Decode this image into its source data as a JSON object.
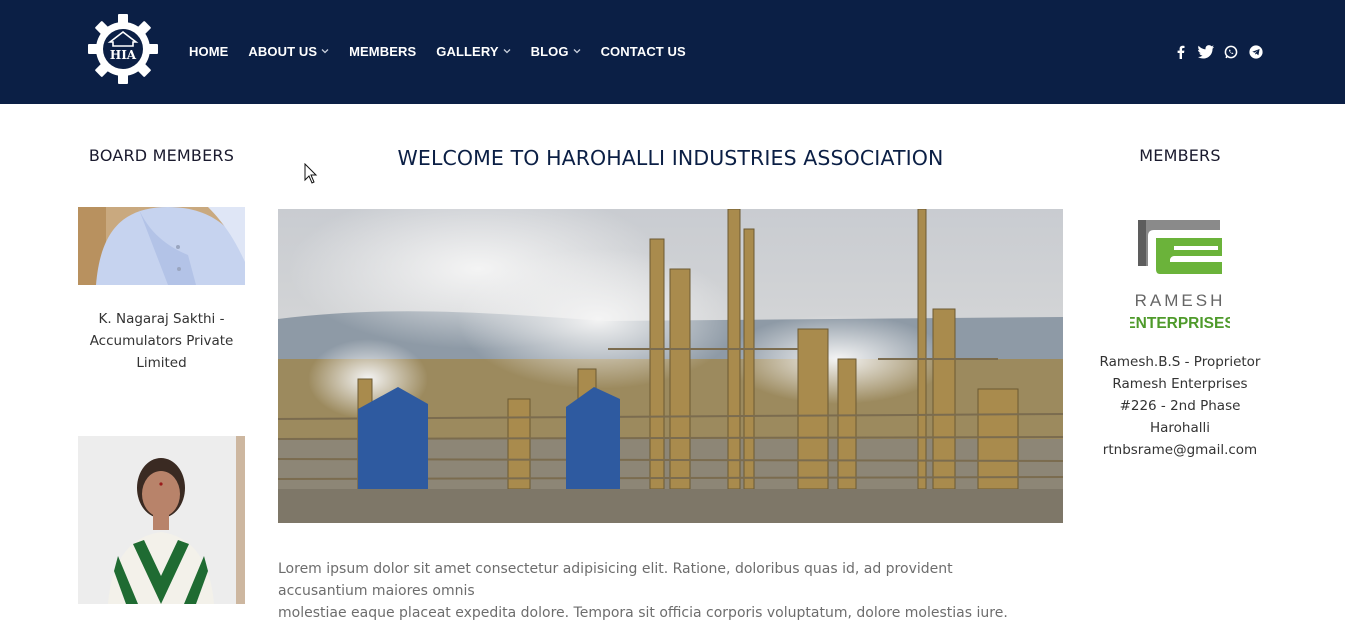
{
  "header": {
    "logo_text": "HIA",
    "nav": [
      {
        "label": "HOME",
        "has_dropdown": false
      },
      {
        "label": "ABOUT US",
        "has_dropdown": true
      },
      {
        "label": "MEMBERS",
        "has_dropdown": false
      },
      {
        "label": "GALLERY",
        "has_dropdown": true
      },
      {
        "label": "BLOG",
        "has_dropdown": true
      },
      {
        "label": "CONTACT US",
        "has_dropdown": false
      }
    ],
    "social_icons": [
      "facebook-icon",
      "twitter-icon",
      "whatsapp-icon",
      "telegram-icon"
    ]
  },
  "left": {
    "title": "BOARD MEMBERS",
    "member1_caption_line1": "K. Nagaraj Sakthi -",
    "member1_caption_line2": "Accumulators Private",
    "member1_caption_line3": "Limited"
  },
  "main": {
    "welcome": "WELCOME TO HAROHALLI INDUSTRIES ASSOCIATION",
    "lorem_line1": "Lorem ipsum dolor sit amet consectetur adipisicing elit. Ratione, doloribus quas id, ad provident accusantium maiores omnis",
    "lorem_line2": "molestiae eaque placeat expedita dolore. Tempora sit officia corporis voluptatum, dolore molestias iure."
  },
  "right": {
    "title": "MEMBERS",
    "logo_word1": "RAMESH",
    "logo_word2": "ENTERPRISES",
    "line1": "Ramesh.B.S - Proprietor",
    "line2": "Ramesh Enterprises",
    "line3": "#226 - 2nd Phase Harohalli",
    "line4": "rtnbsrame@gmail.com"
  },
  "colors": {
    "header_bg": "#0b1f45",
    "accent_green": "#4e9a2a"
  }
}
